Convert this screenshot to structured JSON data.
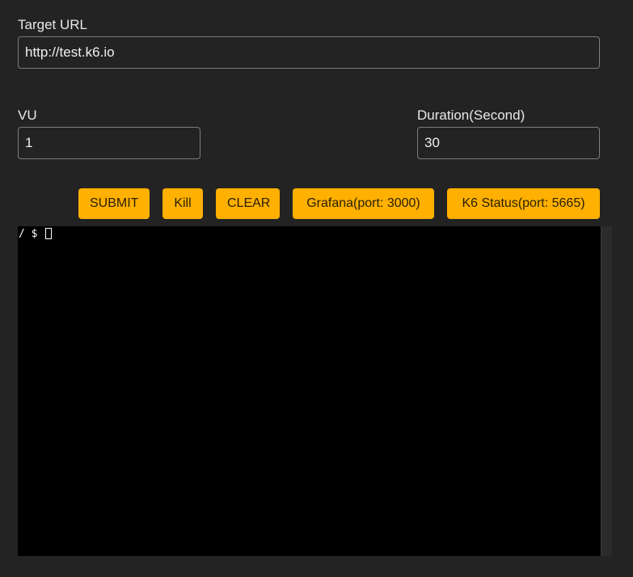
{
  "form": {
    "target_url": {
      "label": "Target URL",
      "value": "http://test.k6.io"
    },
    "vu": {
      "label": "VU",
      "value": "1"
    },
    "duration": {
      "label": "Duration(Second)",
      "value": "30"
    }
  },
  "actions": {
    "submit": "SUBMIT",
    "kill": "Kill",
    "clear": "CLEAR",
    "grafana": "Grafana(port: 3000)",
    "k6_status": "K6 Status(port: 5665)"
  },
  "terminal": {
    "prompt": "/ $ "
  },
  "colors": {
    "background": "#232323",
    "button_accent": "#ffb000",
    "terminal_bg": "#000000"
  }
}
